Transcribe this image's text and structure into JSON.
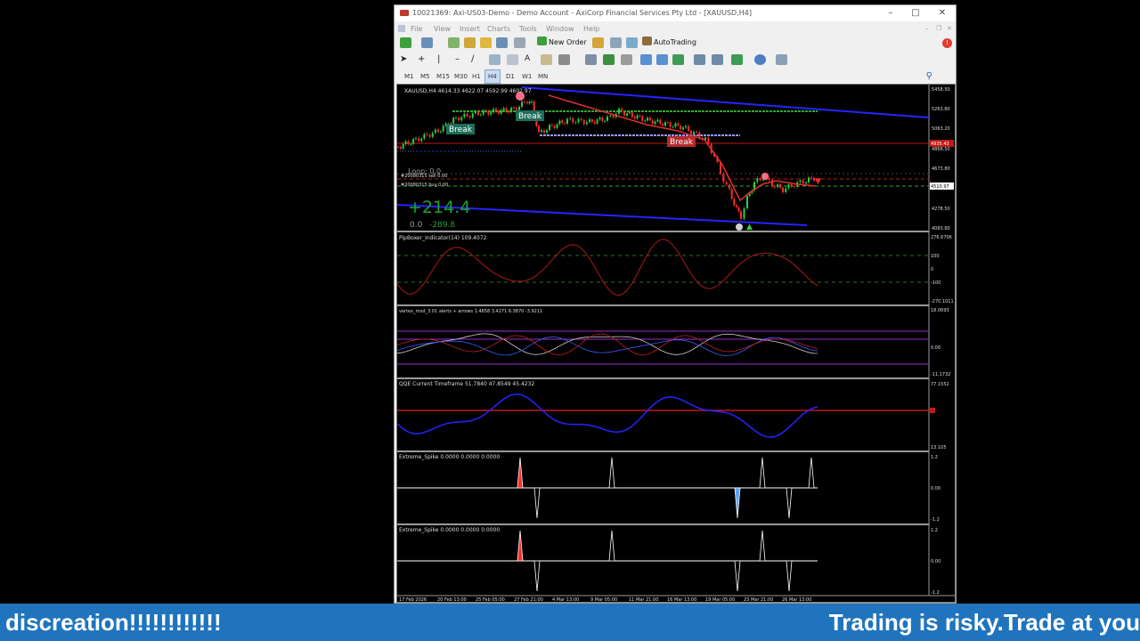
{
  "window": {
    "title": "10021369: Axi-US03-Demo - Demo Account - AxiCorp Financial Services Pty Ltd - [XAUUSD,H4]"
  },
  "menu": [
    "File",
    "View",
    "Insert",
    "Charts",
    "Tools",
    "Window",
    "Help"
  ],
  "toolbar": {
    "new_order": "New Order",
    "autotrading": "AutoTrading"
  },
  "timeframes": [
    "M1",
    "M5",
    "M15",
    "M30",
    "H1",
    "H4",
    "D1",
    "W1",
    "MN"
  ],
  "active_timeframe": "H4",
  "main_chart": {
    "symbol_header": "XAUUSD,H4  4614.33 4622.07 4592.99 4602.97",
    "price_labels": [
      "5458.50",
      "5263.80",
      "5063.20",
      "4868.50",
      "4673.80",
      "4278.50",
      "4083.80"
    ],
    "current_price": "4510.97",
    "red_level_price": "4935.43",
    "break_labels": [
      "Break",
      "Break",
      "Break"
    ],
    "info_line1": "Loop: 0.0",
    "info_line2": "#20080315 sell 0.00",
    "info_line3": "#20080315 buy 0.00",
    "pnl_big": "+214.4",
    "info_zero": "0.0",
    "pnl_small": "-289.8"
  },
  "indicators": [
    {
      "name": "PipBoxer_Indicator(14) 109.4072",
      "scale": [
        "276.6706",
        "100",
        "0",
        "-100",
        "-270.1011"
      ]
    },
    {
      "name": "vertex_mod_3.01 alerts + arrows 1.4658 3.4271 6.3870 -3.9211",
      "scale": [
        "18.0693",
        "0.00",
        "-11.1732"
      ]
    },
    {
      "name": "QQE Current Timeframe 51.7840 47.8549 45.4232",
      "scale": [
        "77.1552",
        "13.105"
      ]
    },
    {
      "name": "Extreme_Spike 0.0000 0.0000 0.0000",
      "scale": [
        "1.2",
        "0.00",
        "-1.2"
      ]
    },
    {
      "name": "Extreme_Spike 0.0000 0.0000 0.0000",
      "scale": [
        "1.2",
        "0.00",
        "-1.2"
      ]
    }
  ],
  "time_axis": [
    "17 Feb 2026",
    "20 Feb 13:00",
    "25 Feb 05:00",
    "27 Feb 21:00",
    "4 Mar 13:00",
    "9 Mar 05:00",
    "11 Mar 21:00",
    "16 Mar 13:00",
    "19 Mar 05:00",
    "23 Mar 21:00",
    "26 Mar 13:00"
  ],
  "banner": {
    "left_text": "discreation!!!!!!!!!!!!",
    "right_text": "Trading is risky.Trade at you"
  },
  "colors": {
    "chart_bg": "#000000",
    "bull": "#2ecc40",
    "bear": "#ff2b2b",
    "trend_blue": "#2424ff",
    "banner_bg": "#1f74bd",
    "spike_red": "#ff2b2b",
    "spike_blue": "#5aa0ff"
  }
}
